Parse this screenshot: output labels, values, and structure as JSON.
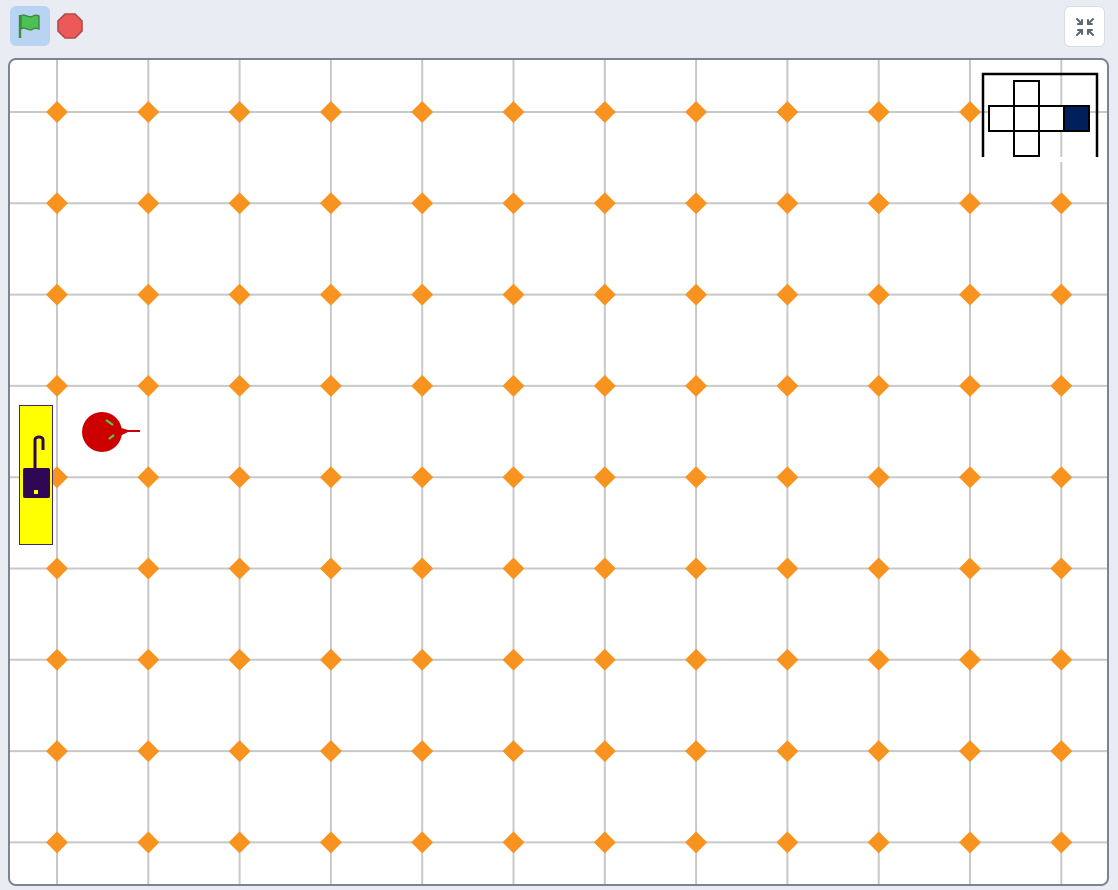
{
  "toolbar": {
    "green_flag": {
      "icon": "green-flag-icon",
      "color": "#4cbf56",
      "active_bg": "#b9d3f3"
    },
    "stop": {
      "icon": "stop-sign-icon",
      "color": "#ec5959"
    },
    "fullscreen": {
      "icon": "exit-fullscreen-icon",
      "color": "#5c6770"
    }
  },
  "stage": {
    "grid": {
      "columns": 12,
      "rows": 9,
      "line_color": "#c8c8c8",
      "dot_color": "#f7931e"
    },
    "gate": {
      "icon": "lock-icon",
      "color": "#ffff00",
      "lock_color": "#2e0854"
    },
    "robot": {
      "icon": "robot-icon",
      "color": "#cc0000",
      "eye_color": "#4cd137"
    },
    "minimap": {
      "icon": "minimap-icon",
      "highlight_color": "#001f5b"
    }
  }
}
